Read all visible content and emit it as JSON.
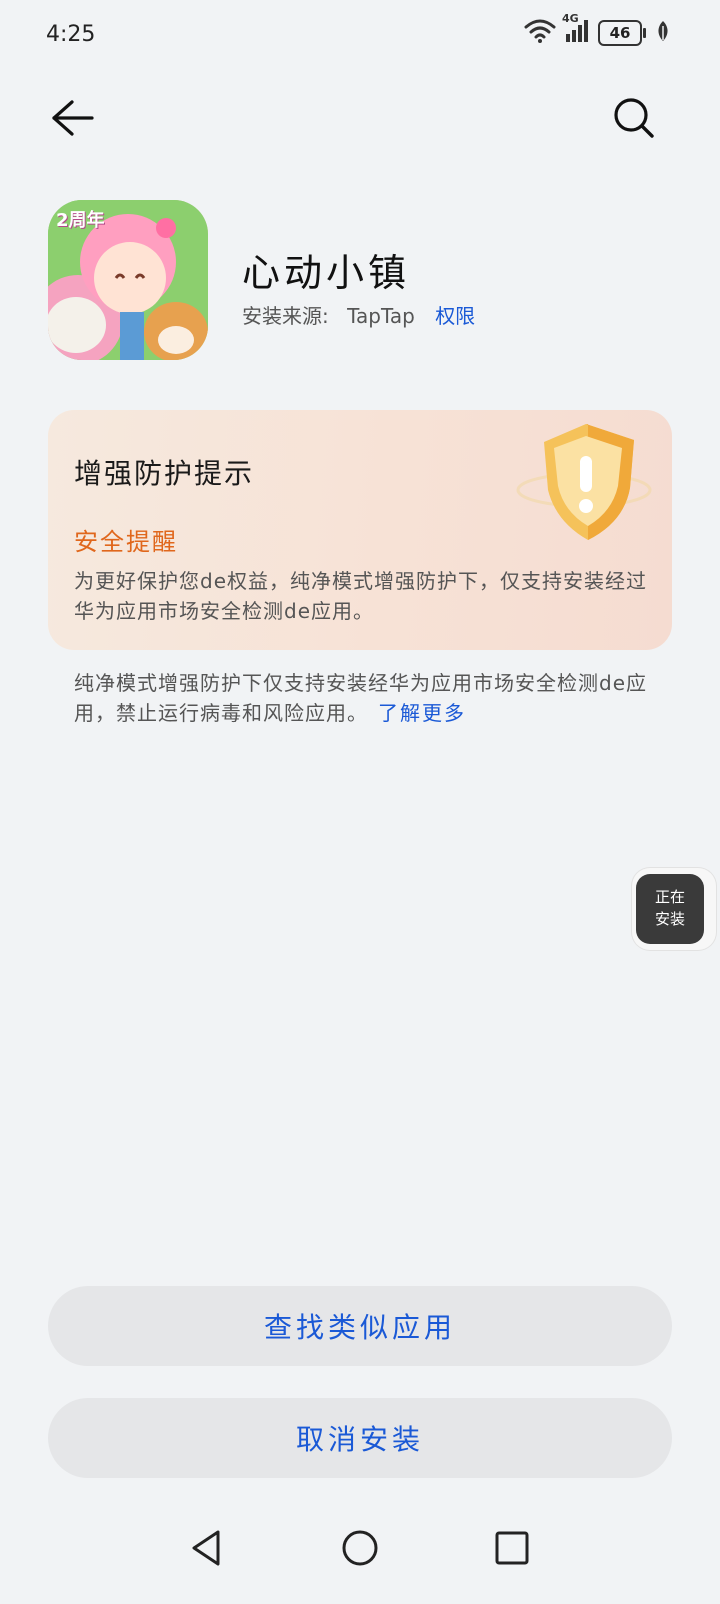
{
  "status_bar": {
    "time": "4:25",
    "network": "4G",
    "battery": "46",
    "icons": [
      "wifi-icon",
      "signal-icon",
      "battery-icon",
      "leaf-icon"
    ]
  },
  "nav": {
    "back_icon": "back-arrow-icon",
    "search_icon": "search-icon"
  },
  "app": {
    "name": "心动小镇",
    "source_label": "安装来源:",
    "source_value": "TapTap",
    "permission_link": "权限",
    "icon_badge": "2周年"
  },
  "protection_card": {
    "title": "增强防护提示",
    "subtitle": "安全提醒",
    "body": "为更好保护您de权益，纯净模式增强防护下，仅支持安装经过华为应用市场安全检测de应用。"
  },
  "notice": {
    "text": "纯净模式增强防护下仅支持安装经华为应用市场安全检测de应用，禁止运行病毒和风险应用。",
    "learn_more": "了解更多"
  },
  "floating_status": {
    "line1": "正在",
    "line2": "安装"
  },
  "buttons": {
    "find_similar": "查找类似应用",
    "cancel_install": "取消安装"
  },
  "colors": {
    "accent": "#1a59d6",
    "warning": "#e0671c",
    "background": "#f1f3f5"
  }
}
